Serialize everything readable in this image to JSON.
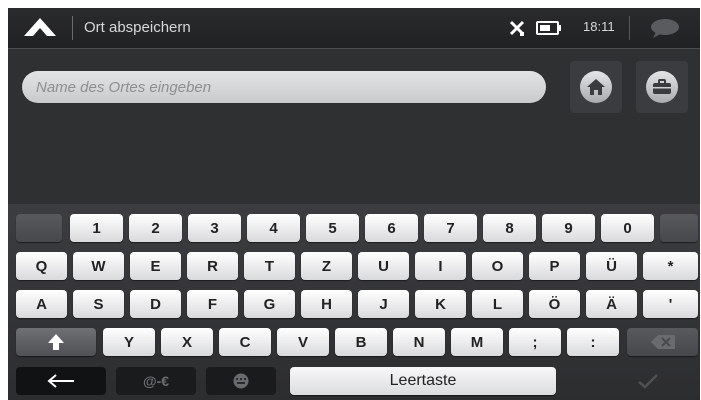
{
  "header": {
    "title": "Ort abspeichern",
    "time": "18:11",
    "icons": {
      "back": "arrow-up-icon",
      "signal": "no-gps-icon",
      "battery": "battery-icon",
      "messages": "message-icon"
    }
  },
  "search": {
    "placeholder": "Name des Ortes eingeben",
    "value": ""
  },
  "side_buttons": [
    {
      "name": "home-icon"
    },
    {
      "name": "briefcase-icon"
    }
  ],
  "keyboard": {
    "number_row": [
      "1",
      "2",
      "3",
      "4",
      "5",
      "6",
      "7",
      "8",
      "9",
      "0"
    ],
    "row1": [
      "Q",
      "W",
      "E",
      "R",
      "T",
      "Z",
      "U",
      "I",
      "O",
      "P",
      "Ü",
      "*"
    ],
    "row2": [
      "A",
      "S",
      "D",
      "F",
      "G",
      "H",
      "J",
      "K",
      "L",
      "Ö",
      "Ä",
      "'"
    ],
    "row3": [
      "Y",
      "X",
      "C",
      "V",
      "B",
      "N",
      "M",
      ";",
      ":"
    ],
    "symbols_label": "@-€",
    "space_label": "Leertaste"
  },
  "colors": {
    "background": "#2e2f31",
    "key_light": "#ffffff",
    "key_dark": "#505154"
  }
}
